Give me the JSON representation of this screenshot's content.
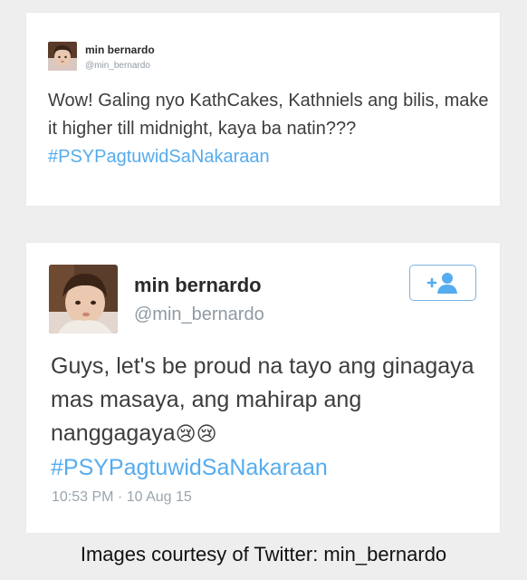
{
  "colors": {
    "background": "#eeeeee",
    "card": "#ffffff",
    "hashtag": "#55acee",
    "handle": "#8f9aa3",
    "follow_button": "#55acee"
  },
  "tweet_small": {
    "name": "min bernardo",
    "handle": "@min_bernardo",
    "text": "Wow! Galing nyo KathCakes, Kathniels ang bilis, make it higher till midnight, kaya ba natin???",
    "hashtag": "#PSYPagtuwidSaNakaraan",
    "avatar_icon": "avatar-photo"
  },
  "tweet_large": {
    "name": "min bernardo",
    "handle": "@min_bernardo",
    "text": "Guys, let's be proud na tayo ang ginagaya mas masaya, ang  mahirap ang nanggagaya",
    "emoji": "😢😢",
    "hashtag": "#PSYPagtuwidSaNakaraan",
    "timestamp": "10:53 PM · 10 Aug 15",
    "follow_icon": "add-user-icon",
    "avatar_icon": "avatar-photo"
  },
  "caption": "Images courtesy of Twitter: min_bernardo"
}
